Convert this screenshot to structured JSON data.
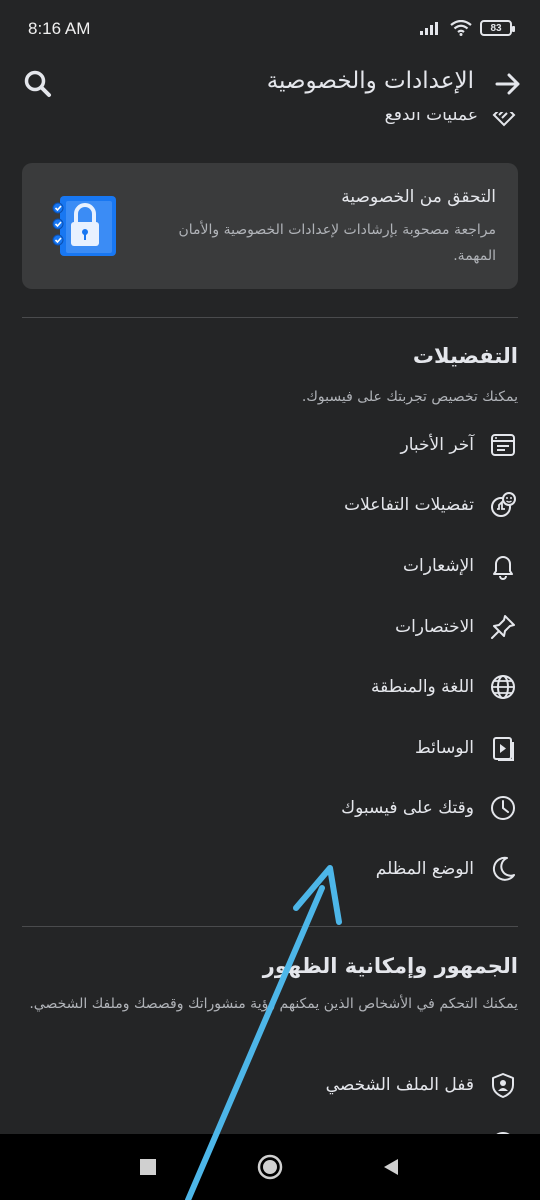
{
  "status_bar": {
    "time": "8:16 AM",
    "battery": "83"
  },
  "app_bar": {
    "title": "الإعدادات والخصوصية"
  },
  "partial_item": {
    "label": "عمليات الدفع"
  },
  "privacy_card": {
    "title": "التحقق من الخصوصية",
    "description": "مراجعة مصحوبة بإرشادات لإعدادات الخصوصية والأمان المهمة."
  },
  "preferences": {
    "heading": "التفضيلات",
    "subtitle": "يمكنك تخصيص تجربتك على فيسبوك.",
    "items": [
      {
        "label": "آخر الأخبار",
        "icon": "news-feed-icon"
      },
      {
        "label": "تفضيلات التفاعلات",
        "icon": "reactions-icon"
      },
      {
        "label": "الإشعارات",
        "icon": "bell-icon"
      },
      {
        "label": "الاختصارات",
        "icon": "pin-icon"
      },
      {
        "label": "اللغة والمنطقة",
        "icon": "globe-icon"
      },
      {
        "label": "الوسائط",
        "icon": "media-icon"
      },
      {
        "label": "وقتك على فيسبوك",
        "icon": "clock-icon"
      },
      {
        "label": "الوضع المظلم",
        "icon": "moon-icon"
      }
    ]
  },
  "audience": {
    "heading": "الجمهور وإمكانية الظهور",
    "subtitle": "يمكنك التحكم في الأشخاص الذين يمكنهم رؤية منشوراتك وقصصك وملفك الشخصي.",
    "items": [
      {
        "label": "قفل الملف الشخصي",
        "icon": "profile-lock-icon"
      }
    ]
  },
  "colors": {
    "background": "#242526",
    "card": "#3a3b3c",
    "text": "#e4e6eb",
    "secondary": "#b0b3b8",
    "annotation_arrow": "#4db6e8"
  }
}
